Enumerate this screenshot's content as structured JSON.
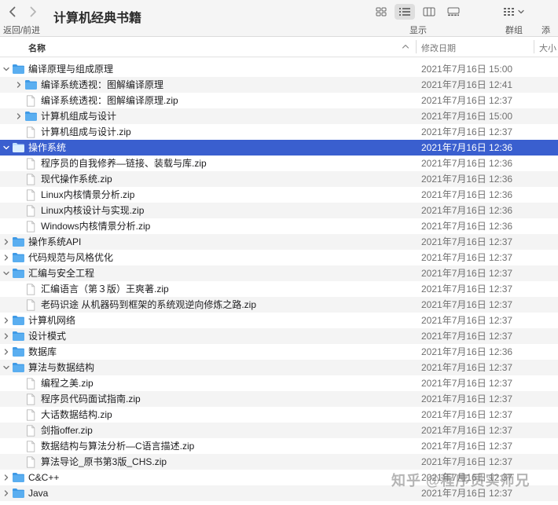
{
  "window": {
    "title": "计算机经典书籍",
    "nav_label": "返回/前进",
    "display_label": "显示",
    "group_label": "群组",
    "add_label": "添加"
  },
  "columns": {
    "name": "名称",
    "date": "修改日期",
    "size": "大小"
  },
  "colors": {
    "selection": "#3a5fcf",
    "folder": "#5aaef0",
    "zebra": "#f4f4f4"
  },
  "rows": [
    {
      "name": "编译原理与组成原理",
      "date": "2021年7月16日 15:00",
      "depth": 0,
      "type": "folder",
      "disclosure": "expanded"
    },
    {
      "name": "编译系统透视：图解编译原理",
      "date": "2021年7月16日 12:41",
      "depth": 1,
      "type": "folder",
      "disclosure": "collapsed"
    },
    {
      "name": "编译系统透视：图解编译原理.zip",
      "date": "2021年7月16日 12:37",
      "depth": 1,
      "type": "file"
    },
    {
      "name": "计算机组成与设计",
      "date": "2021年7月16日 15:00",
      "depth": 1,
      "type": "folder",
      "disclosure": "collapsed"
    },
    {
      "name": "计算机组成与设计.zip",
      "date": "2021年7月16日 12:37",
      "depth": 1,
      "type": "file"
    },
    {
      "name": "操作系统",
      "date": "2021年7月16日 12:36",
      "depth": 0,
      "type": "folder",
      "disclosure": "expanded",
      "selected": true
    },
    {
      "name": "程序员的自我修养—链接、装载与库.zip",
      "date": "2021年7月16日 12:36",
      "depth": 1,
      "type": "file"
    },
    {
      "name": "现代操作系统.zip",
      "date": "2021年7月16日 12:36",
      "depth": 1,
      "type": "file"
    },
    {
      "name": "Linux内核情景分析.zip",
      "date": "2021年7月16日 12:36",
      "depth": 1,
      "type": "file"
    },
    {
      "name": "Linux内核设计与实现.zip",
      "date": "2021年7月16日 12:36",
      "depth": 1,
      "type": "file"
    },
    {
      "name": "Windows内核情景分析.zip",
      "date": "2021年7月16日 12:36",
      "depth": 1,
      "type": "file"
    },
    {
      "name": "操作系统API",
      "date": "2021年7月16日 12:37",
      "depth": 0,
      "type": "folder",
      "disclosure": "collapsed"
    },
    {
      "name": "代码规范与风格优化",
      "date": "2021年7月16日 12:37",
      "depth": 0,
      "type": "folder",
      "disclosure": "collapsed"
    },
    {
      "name": "汇编与安全工程",
      "date": "2021年7月16日 12:37",
      "depth": 0,
      "type": "folder",
      "disclosure": "expanded"
    },
    {
      "name": "汇编语言（第３版）王爽著.zip",
      "date": "2021年7月16日 12:37",
      "depth": 1,
      "type": "file"
    },
    {
      "name": "老码识途 从机器码到框架的系统观逆向修炼之路.zip",
      "date": "2021年7月16日 12:37",
      "depth": 1,
      "type": "file"
    },
    {
      "name": "计算机网络",
      "date": "2021年7月16日 12:37",
      "depth": 0,
      "type": "folder",
      "disclosure": "collapsed"
    },
    {
      "name": "设计模式",
      "date": "2021年7月16日 12:37",
      "depth": 0,
      "type": "folder",
      "disclosure": "collapsed"
    },
    {
      "name": "数据库",
      "date": "2021年7月16日 12:36",
      "depth": 0,
      "type": "folder",
      "disclosure": "collapsed"
    },
    {
      "name": "算法与数据结构",
      "date": "2021年7月16日 12:37",
      "depth": 0,
      "type": "folder",
      "disclosure": "expanded"
    },
    {
      "name": "编程之美.zip",
      "date": "2021年7月16日 12:37",
      "depth": 1,
      "type": "file"
    },
    {
      "name": "程序员代码面试指南.zip",
      "date": "2021年7月16日 12:37",
      "depth": 1,
      "type": "file"
    },
    {
      "name": "大话数据结构.zip",
      "date": "2021年7月16日 12:37",
      "depth": 1,
      "type": "file"
    },
    {
      "name": "剑指offer.zip",
      "date": "2021年7月16日 12:37",
      "depth": 1,
      "type": "file"
    },
    {
      "name": "数据结构与算法分析—C语言描述.zip",
      "date": "2021年7月16日 12:37",
      "depth": 1,
      "type": "file"
    },
    {
      "name": "算法导论_原书第3版_CHS.zip",
      "date": "2021年7月16日 12:37",
      "depth": 1,
      "type": "file"
    },
    {
      "name": "C&C++",
      "date": "2021年7月16日 12:37",
      "depth": 0,
      "type": "folder",
      "disclosure": "collapsed"
    },
    {
      "name": "Java",
      "date": "2021年7月16日 12:37",
      "depth": 0,
      "type": "folder",
      "disclosure": "collapsed"
    }
  ],
  "watermark": "知乎 @程序员实师兄"
}
